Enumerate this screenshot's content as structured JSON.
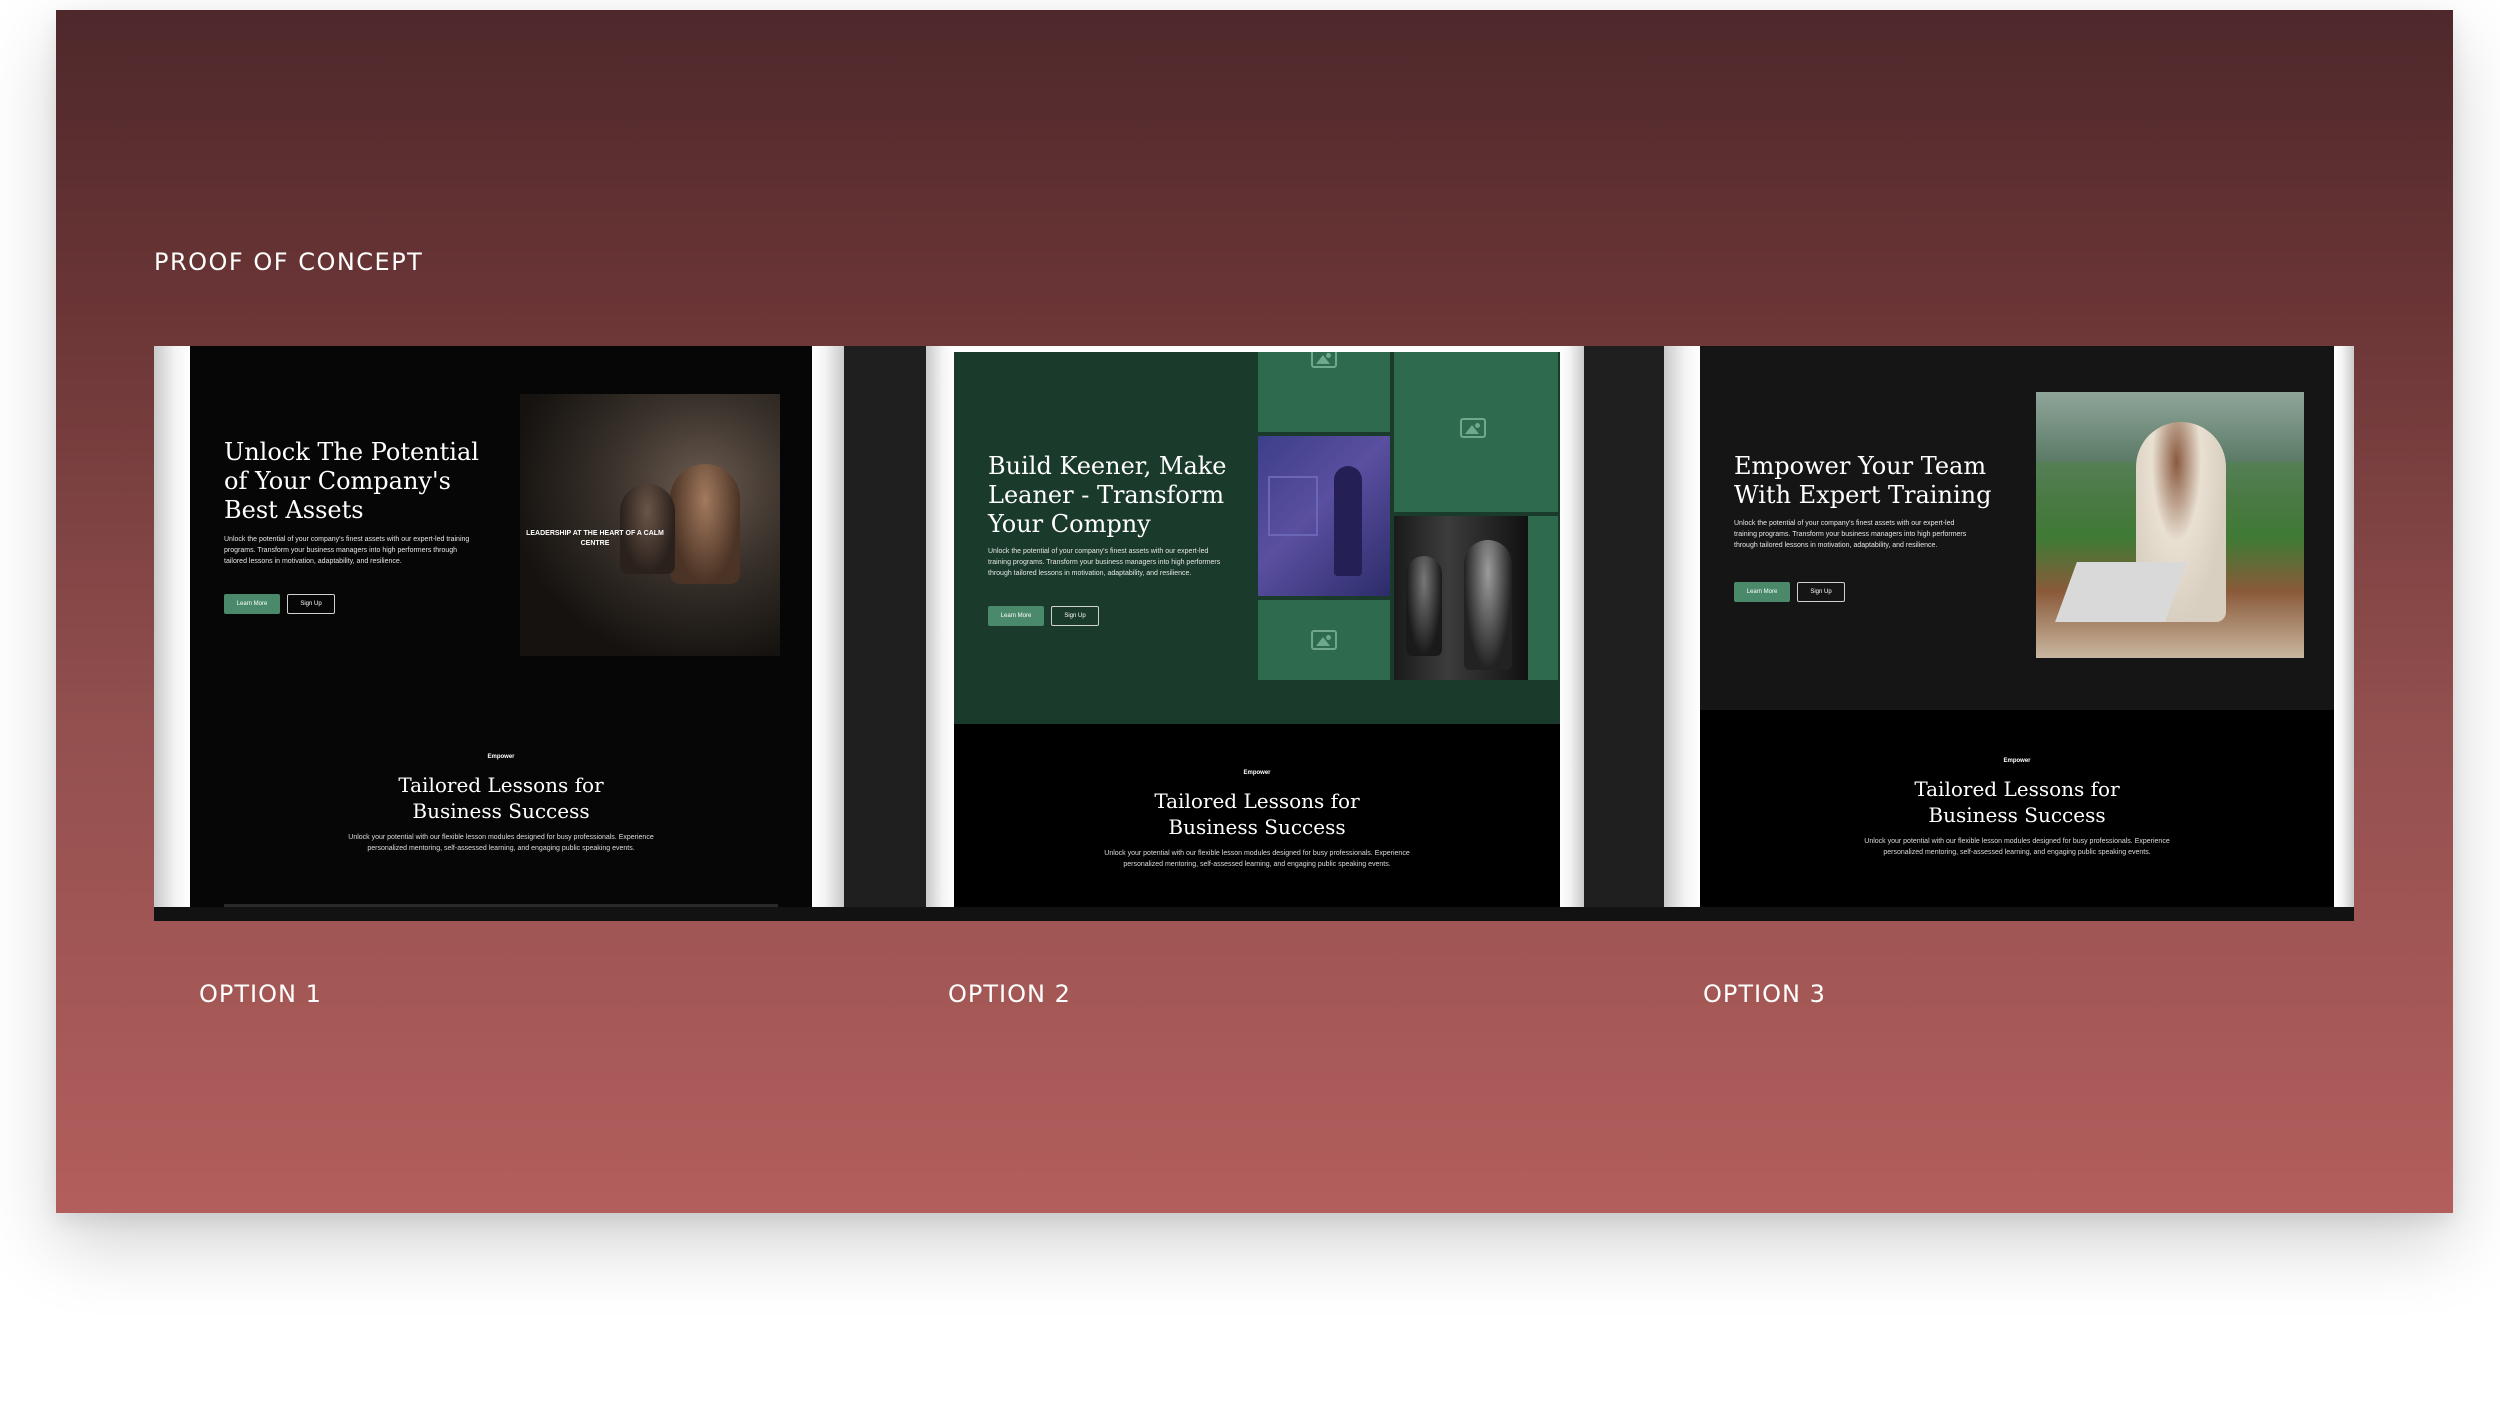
{
  "slide": {
    "heading": "PROOF OF CONCEPT"
  },
  "options": [
    {
      "label": "OPTION 1",
      "hero_title": "Unlock The Potential of Your Company's Best Assets",
      "hero_body": "Unlock the potential of your company's finest assets with our expert-led training programs. Transform your business managers into high performers through tailored lessons in motivation, adaptability, and resilience.",
      "primary_btn": "Learn More",
      "secondary_btn": "Sign Up",
      "image_caption": "LEADERSHIP AT THE HEART OF A CALM CENTRE",
      "eyebrow": "Empower",
      "section_title": "Tailored Lessons for Business Success",
      "section_body": "Unlock your potential with our flexible lesson modules designed for busy professionals. Experience personalized mentoring, self-assessed learning, and engaging public speaking events."
    },
    {
      "label": "OPTION 2",
      "hero_title": "Build Keener, Make Leaner - Transform Your Compny",
      "hero_body": "Unlock the potential of your company's finest assets with our expert-led training programs. Transform your business managers into high performers through tailored lessons in motivation, adaptability, and resilience.",
      "primary_btn": "Learn More",
      "secondary_btn": "Sign Up",
      "eyebrow": "Empower",
      "section_title": "Tailored Lessons for Business Success",
      "section_body": "Unlock your potential with our flexible lesson modules designed for busy professionals. Experience personalized mentoring, self-assessed learning, and engaging public speaking events."
    },
    {
      "label": "OPTION 3",
      "hero_title": "Empower Your Team With Expert Training",
      "hero_body": "Unlock the potential of your company's finest assets with our expert-led training programs. Transform your business managers into high performers through tailored lessons in motivation, adaptability, and resilience.",
      "primary_btn": "Learn More",
      "secondary_btn": "Sign Up",
      "eyebrow": "Empower",
      "section_title": "Tailored Lessons for Business Success",
      "section_body": "Unlock your potential with our flexible lesson modules designed for busy professionals. Experience personalized mentoring, self-assessed learning, and engaging public speaking events."
    }
  ],
  "colors": {
    "slide_top": "#4e282b",
    "slide_bottom": "#b25e5c",
    "accent_green": "#4a8a6a",
    "option2_bg": "#1a3a2b"
  }
}
